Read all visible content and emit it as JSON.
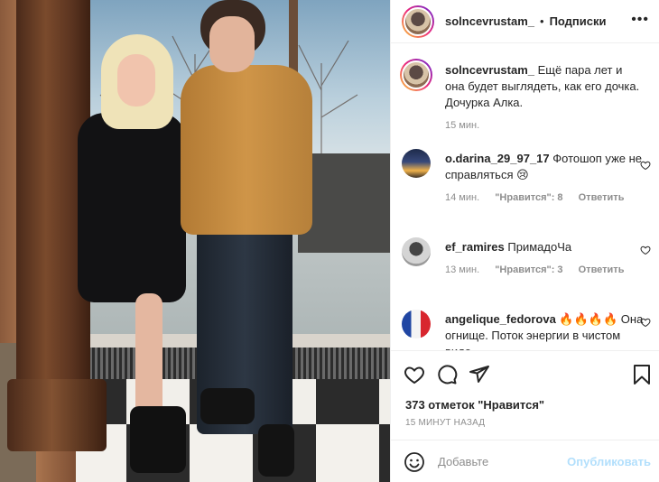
{
  "post": {
    "username": "solncevrustam_",
    "separator": "•",
    "follow_label": "Подписки",
    "more_label": "•••"
  },
  "comments": [
    {
      "username": "solncevrustam_",
      "text": " Ещё пара лет и она будет выглядеть, как его дочка. Дочурка Алка.",
      "time": "15 мин.",
      "likes": "",
      "reply": ""
    },
    {
      "username": "o.darina_29_97_17",
      "text": " Фотошоп уже не справляться 😢",
      "time": "14 мин.",
      "likes": "\"Нравится\": 8",
      "reply": "Ответить"
    },
    {
      "username": "ef_ramires",
      "text": " ПримадоЧа",
      "time": "13 мин.",
      "likes": "\"Нравится\": 3",
      "reply": "Ответить"
    },
    {
      "username": "angelique_fedorova",
      "text": " 🔥🔥🔥🔥 Она огнище. Поток энергии в чистом виде",
      "time": "",
      "likes": "",
      "reply": ""
    }
  ],
  "stats": {
    "likes": "373 отметок \"Нравится\"",
    "time": "15 МИНУТ НАЗАД"
  },
  "comment_box": {
    "placeholder": "Добавьте",
    "publish_label": "Опубликовать"
  },
  "colors": {
    "text": "#262626",
    "muted": "#8e8e8e",
    "publish_disabled": "#b2dffc",
    "border": "#efefef"
  },
  "icons": [
    "heart-icon",
    "comment-icon",
    "share-icon",
    "bookmark-icon",
    "smile-icon",
    "more-icon"
  ]
}
